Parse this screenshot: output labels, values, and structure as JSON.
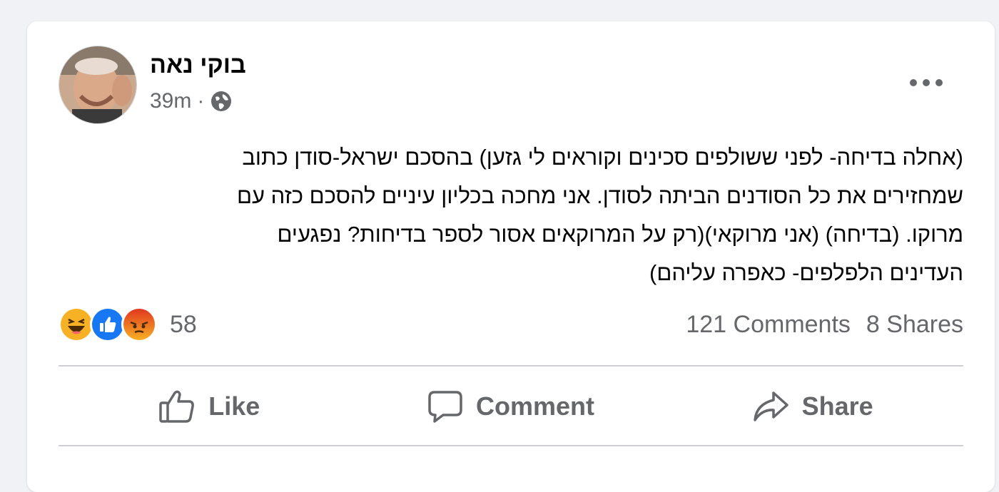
{
  "post": {
    "author": "בוקי נאה",
    "time": "39m",
    "separator": "·",
    "privacy_icon": "globe-icon",
    "more_icon": "more-options-icon",
    "text": {
      "line1": "(אחלה בדיחה- לפני ששולפים סכינים וקוראים לי גזען) בהסכם  ישראל-סודן כתוב",
      "line2": "שמחזירים את כל הסודנים הביתה לסודן. אני מחכה בכליון עיניים להסכם כזה עם",
      "line3": "מרוקו. (בדיחה) (אני מרוקאי)(רק על המרוקאים אסור לספר בדיחות? נפגעים",
      "line4": "העדינים הלפלפים- כאפרה עליהם)"
    },
    "reactions": {
      "icons": [
        "haha-icon",
        "like-icon",
        "angry-icon"
      ],
      "count": "58"
    },
    "comments_count": "121 Comments",
    "shares_count": "8 Shares",
    "actions": {
      "like": "Like",
      "comment": "Comment",
      "share": "Share"
    }
  },
  "colors": {
    "background": "#f0f2f5",
    "card": "#ffffff",
    "secondary_text": "#65676b",
    "like_blue": "#1877f2",
    "haha_yellow": "#f7b125",
    "angry_orange": "#e9710f"
  }
}
